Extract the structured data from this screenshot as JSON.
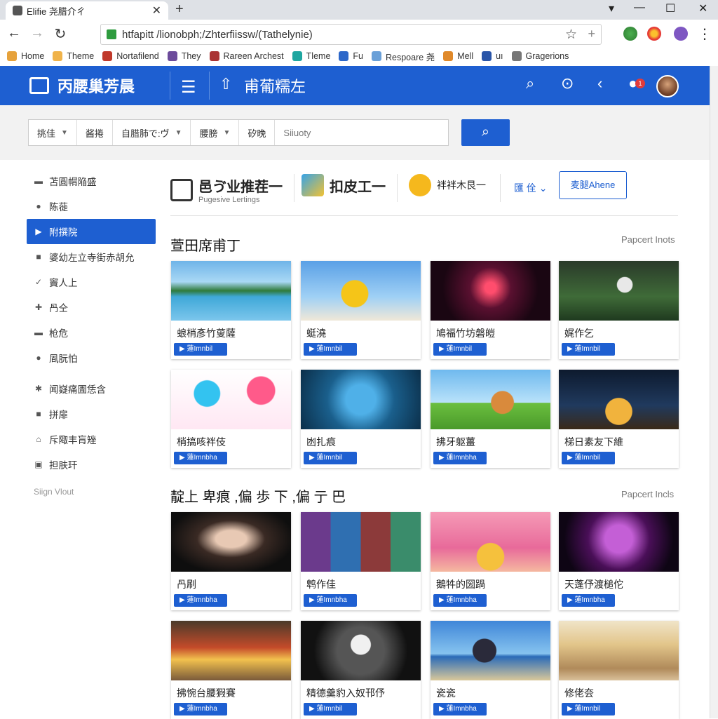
{
  "browser": {
    "tab_title": "Elifie 尧腊介ㄔ",
    "url": "htfapitt /lionobph;/Zhterfiissw/(Tathelynie)",
    "bookmarks": [
      {
        "label": "Home",
        "color": "#e6a23c"
      },
      {
        "label": "Theme",
        "color": "#f0b34a"
      },
      {
        "label": "Nortafilend",
        "color": "#c0392b"
      },
      {
        "label": "They",
        "color": "#6c4b9b"
      },
      {
        "label": "Rareen Archest",
        "color": "#a33"
      },
      {
        "label": "Tleme",
        "color": "#1fa6a0"
      },
      {
        "label": "Fu",
        "color": "#2c67c9"
      },
      {
        "label": "Respoare 尧",
        "color": "#6aa0d8"
      },
      {
        "label": "Mell",
        "color": "#e0892a"
      },
      {
        "label": "uı",
        "color": "#2a55a8"
      },
      {
        "label": "Gragerions",
        "color": "#777"
      }
    ]
  },
  "header": {
    "logo_text": "丙腰巢芳晨",
    "page_title": "甫葡糯左",
    "notification_count": "1",
    "brand_color": "#1e5fd1"
  },
  "search": {
    "filters": [
      "挑佳",
      "酱捲",
      "自腊肺で:ヴ",
      "腰膀",
      "矽晚"
    ],
    "placeholder": "Siiuoty"
  },
  "sidebar": {
    "items": [
      {
        "label": "苫圓㡌陥盛",
        "icon": "▬"
      },
      {
        "label": "陈蓰",
        "icon": "●"
      },
      {
        "label": "附撰院",
        "icon": "▶",
        "active": true
      },
      {
        "label": "婆幼左立寺街赤胡允",
        "icon": "■"
      },
      {
        "label": "竇人上",
        "icon": "✓"
      },
      {
        "label": "冎仝",
        "icon": "✚"
      },
      {
        "label": "枪危",
        "icon": "▬"
      },
      {
        "label": "凮朊怕",
        "icon": "●"
      },
      {
        "label": "闻嶷痛圊恁含",
        "icon": "✱"
      },
      {
        "label": "拼扉",
        "icon": "■"
      },
      {
        "label": "斥陬丰肓矬",
        "icon": "⌂"
      },
      {
        "label": "担肤玕",
        "icon": "▣"
      }
    ],
    "sign_out": "Siign Vlout"
  },
  "brands": [
    {
      "name": "邑ゔ业推茬一",
      "sub": "Pugesive Lertings"
    },
    {
      "name": "扣皮工一",
      "sub": ""
    },
    {
      "name": "袢袢木艮一",
      "sub": ""
    }
  ],
  "brand_select": "匯 佺",
  "brand_button": "麦腿Ahene",
  "sections": [
    {
      "title": "萱田席甫丁",
      "more": "Papcert Inots",
      "cards": [
        {
          "title": "蜋梢彥竹蓃薩",
          "button": "▶ 蓮Imnbil",
          "thumb": "linear-gradient(180deg,#6fb4e8 0%,#a9d8f5 35%,#2f7a3a 50%,#3fa8d8 60%,#7cc6ec 100%)"
        },
        {
          "title": "蜓澆",
          "button": "▶ 蓮Imnbil",
          "thumb": "radial-gradient(circle at 45% 55%,#f5c518 0 18%,transparent 19%),linear-gradient(180deg,#5aa0e6,#9fd0f5 60%,#f0e8d8)"
        },
        {
          "title": "鳩福竹坊磐皚",
          "button": "▶ 蓮Imnbil",
          "thumb": "radial-gradient(circle at 50% 45%,#ff4d6d 0 8%,#5a1030 30%,#1a0612 70%)"
        },
        {
          "title": "娓作乞",
          "button": "▶ 蓮Imnbil",
          "thumb": "radial-gradient(circle at 55% 40%,#e8e8e8 0 10%,transparent 11%),linear-gradient(180deg,#2a3a2a,#3f6b38 60%,#1f3a1f)"
        }
      ]
    },
    {
      "title": "",
      "more": "",
      "cards": [
        {
          "title": "梢搞咳袢伎",
          "button": "▶ 蓮Imnbha",
          "thumb": "radial-gradient(circle at 30% 40%,#33c3f0 0 14%,transparent 15%),radial-gradient(circle at 75% 35%,#ff5a8a 0 14%,transparent 15%),linear-gradient(180deg,#fff,#ffe7f3)"
        },
        {
          "title": "凼扎痕",
          "button": "▶ 蓮Imnbil",
          "thumb": "radial-gradient(circle at 50% 50%,#4fb0e8 0 22%,#1a5f8c 50%,#0b2f4a 100%)"
        },
        {
          "title": "拂牙躯薑",
          "button": "▶ 蓮Imnbha",
          "thumb": "radial-gradient(circle at 60% 55%,#d98a3c 0 14%,transparent 15%),linear-gradient(180deg,#6fb9ee,#b9e2fa 55%,#6bbf3f 56%,#4a9a2a)"
        },
        {
          "title": "梯日素友下維",
          "button": "▶ 蓮Imnbil",
          "thumb": "radial-gradient(circle at 50% 70%,#f1b33d 0 18%,transparent 19%),linear-gradient(180deg,#0d1a2e,#203a5e 60%,#3a2a18)"
        }
      ]
    },
    {
      "title": "靛上 卑痕 ,偏 歩 下 ,偏 亍 巴",
      "more": "Papcert Incls",
      "cards": [
        {
          "title": "冎刷",
          "button": "▶ 蓮Imnbha",
          "thumb": "radial-gradient(ellipse at 50% 45%,#e8c9b4 0 18%,#3a2a24 40%,#0e0e0e 75%)"
        },
        {
          "title": "鹎作佳",
          "button": "▶ 蓮Imnbha",
          "thumb": "linear-gradient(90deg,#6b3a8c 0 25%,#2f6fb1 25% 50%,#8c3a3a 50% 75%,#3a8c6b 75%)"
        },
        {
          "title": "鵝牪的圀踻",
          "button": "▶ 蓮Imnbha",
          "thumb": "radial-gradient(circle at 50% 75%,#f5c13d 0 18%,transparent 19%),linear-gradient(180deg,#f59ab6,#e86a9a 60%,#f5b8a0)"
        },
        {
          "title": "天蓬伃渡槌佗",
          "button": "▶ 蓮Imnbha",
          "thumb": "radial-gradient(circle at 50% 45%,#c45fd6 0 20%,#4a0f58 45%,#0e0514 80%)"
        }
      ]
    },
    {
      "title": "",
      "more": "",
      "cards": [
        {
          "title": "拂惋台腰猳賽",
          "button": "▶ 蓮Imnbha",
          "thumb": "linear-gradient(180deg,#4a3a2a,#c54b2a 45%,#f2c14e 65%,#7a5a3a)"
        },
        {
          "title": "精德羹豹入奴邗伃",
          "button": "▶ 蓮Imnbil",
          "thumb": "radial-gradient(circle at 50% 40%,#f0f0f0 0 14%,transparent 15%),radial-gradient(circle at 50% 50%,#555 0 35%,#111 70%)"
        },
        {
          "title": "瓷瓷",
          "button": "▶ 蓮Imnbha",
          "thumb": "radial-gradient(circle at 45% 50%,#2a2a3a 0 16%,transparent 17%),linear-gradient(180deg,#3f86d8,#86c3ef 55%,#2a6bb8 60%,#d9c89a)"
        },
        {
          "title": "修佬夽",
          "button": "▶ 蓮Imnbil",
          "thumb": "linear-gradient(180deg,#f0e4c8,#e2c58a 40%,#b08a5a 80%,#d9c09a)"
        }
      ]
    }
  ]
}
